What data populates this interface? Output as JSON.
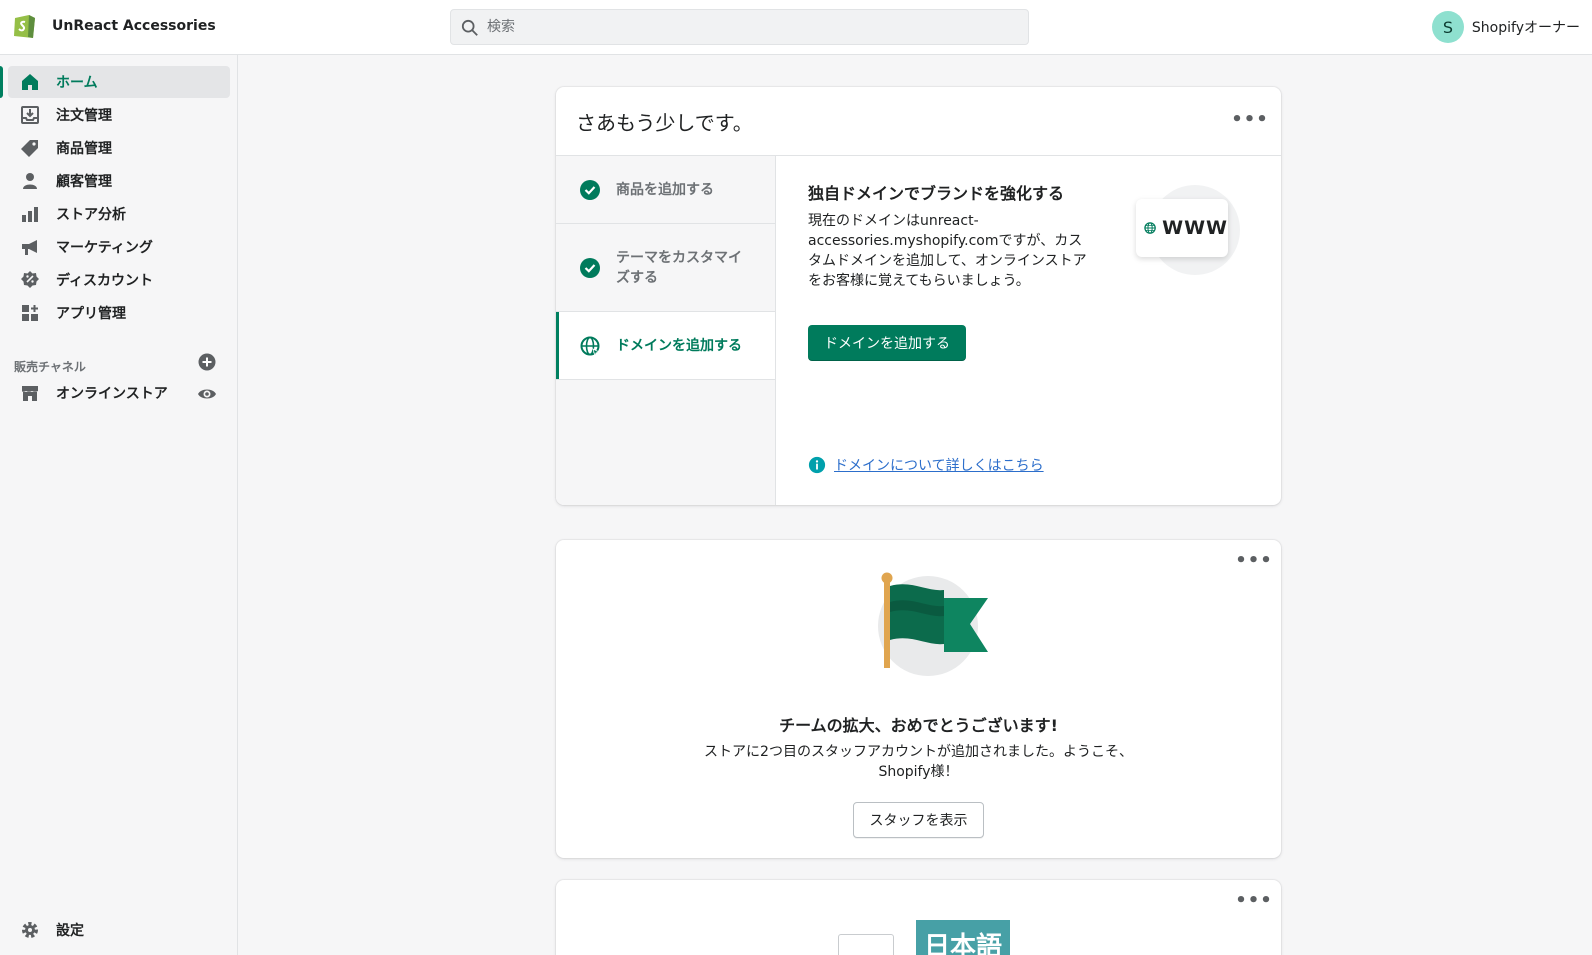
{
  "topbar": {
    "store_name": "UnReact Accessories",
    "search_placeholder": "検索",
    "account_initial": "S",
    "account_name": "Shopifyオーナー"
  },
  "sidebar": {
    "items": [
      {
        "label": "ホーム",
        "icon": "home-icon",
        "active": true
      },
      {
        "label": "注文管理",
        "icon": "orders-icon"
      },
      {
        "label": "商品管理",
        "icon": "tag-icon"
      },
      {
        "label": "顧客管理",
        "icon": "customer-icon"
      },
      {
        "label": "ストア分析",
        "icon": "analytics-icon"
      },
      {
        "label": "マーケティング",
        "icon": "megaphone-icon"
      },
      {
        "label": "ディスカウント",
        "icon": "discount-icon"
      },
      {
        "label": "アプリ管理",
        "icon": "apps-icon"
      }
    ],
    "channels_title": "販売チャネル",
    "online_store_label": "オンラインストア",
    "settings_label": "設定"
  },
  "setup_card": {
    "title": "さあもう少しです。",
    "steps": [
      {
        "label": "商品を追加する",
        "done": true
      },
      {
        "label_line1": "テーマをカスタマイ",
        "label_line2": "ズする",
        "done": true
      },
      {
        "label": "ドメインを追加する",
        "active": true
      }
    ],
    "detail_title": "独自ドメインでブランドを強化する",
    "detail_desc": "現在のドメインはunreact-accessories.myshopify.comですが、カスタムドメインを追加して、オンラインストアをお客様に覚えてもらいましょう。",
    "primary_button": "ドメインを追加する",
    "www_label": "WWW",
    "learn_more_link": "ドメインについて詳しくはこちら"
  },
  "team_card": {
    "title": "チームの拡大、おめでとうございます!",
    "desc": "ストアに2つ目のスタッフアカウントが追加されました。ようこそ、 Shopify様！",
    "button": "スタッフを表示"
  },
  "language_card": {
    "lang_label": "日本語"
  },
  "colors": {
    "accent": "#008060",
    "link": "#2c6ecb",
    "avatar": "#8ee0cf"
  }
}
